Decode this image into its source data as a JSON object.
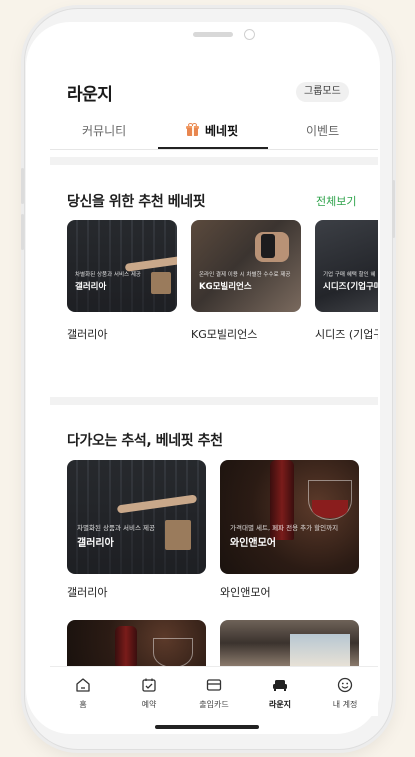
{
  "header": {
    "title": "라운지",
    "group_mode_label": "그룹모드"
  },
  "tabs": [
    {
      "label": "커뮤니티",
      "active": false
    },
    {
      "label": "베네핏",
      "active": true,
      "icon": "gift-icon"
    },
    {
      "label": "이벤트",
      "active": false
    }
  ],
  "recommended": {
    "title": "당신을 위한 추천 베네핏",
    "see_all": "전체보기",
    "cards": [
      {
        "subtitle": "차별화된 상품과 서비스 제공",
        "title": "갤러리아",
        "label": "갤러리아"
      },
      {
        "subtitle": "온라인 결제 이용 시 차별한 수수료 제공",
        "title": "KG모빌리언스",
        "label": "KG모빌리언스"
      },
      {
        "subtitle": "기업 구매 혜택 할인 혜",
        "title": "시디즈(기업구매",
        "label": "시디즈 (기업구"
      }
    ]
  },
  "chuseok": {
    "title": "다가오는 추석, 베네핏 추천",
    "cards": [
      {
        "subtitle": "차별화된 상품과 서비스 제공",
        "title": "갤러리아",
        "label": "갤러리아"
      },
      {
        "subtitle": "가격대별 세트, 페파 전용 추가 할인까지",
        "title": "와인앤모어",
        "label": "와인앤모어"
      }
    ]
  },
  "tabbar": [
    {
      "label": "홈",
      "icon": "home-icon",
      "active": false
    },
    {
      "label": "예약",
      "icon": "calendar-check-icon",
      "active": false
    },
    {
      "label": "출입카드",
      "icon": "card-icon",
      "active": false
    },
    {
      "label": "라운지",
      "icon": "sofa-icon",
      "active": true
    },
    {
      "label": "내 계정",
      "icon": "smile-icon",
      "active": false
    }
  ],
  "colors": {
    "accent_green": "#2fa34b",
    "gift_orange": "#e8864f"
  }
}
